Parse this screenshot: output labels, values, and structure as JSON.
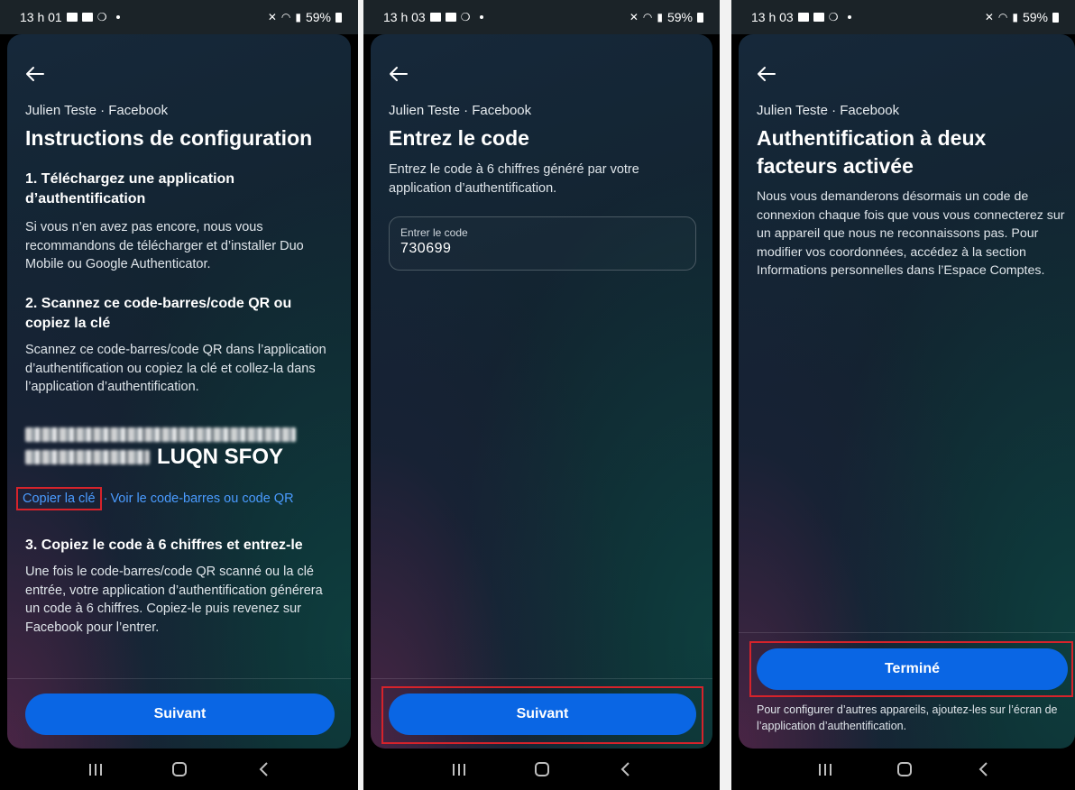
{
  "screens": [
    {
      "status": {
        "time": "13 h 01",
        "battery": "59%"
      },
      "account": "Julien Teste · Facebook",
      "title": "Instructions de configuration",
      "step1": {
        "heading": "1. Téléchargez une application d’authentification",
        "text": "Si vous n’en avez pas encore, nous vous recommandons de télécharger et d’installer Duo Mobile ou Google Authenticator."
      },
      "step2": {
        "heading": "2. Scannez ce code-barres/code QR ou copiez la clé",
        "text": "Scannez ce code-barres/code QR dans l’application d’authentification ou copiez la clé et collez-la dans l’application d’authentification.",
        "key_visible": "LUQN SFOY",
        "copy_key_label": "Copier la clé",
        "view_qr_label": "Voir le code-barres ou code QR"
      },
      "step3": {
        "heading": "3. Copiez le code à 6 chiffres et entrez-le",
        "text": "Une fois le code-barres/code QR scanné ou la clé entrée, votre application d’authentification générera un code à 6 chiffres. Copiez-le puis revenez sur Facebook pour l’entrer."
      },
      "button": "Suivant"
    },
    {
      "status": {
        "time": "13 h 03",
        "battery": "59%"
      },
      "account": "Julien Teste · Facebook",
      "title": "Entrez le code",
      "description": "Entrez le code à 6 chiffres généré par votre application d’authentification.",
      "field": {
        "label": "Entrer le code",
        "value": "730699"
      },
      "button": "Suivant"
    },
    {
      "status": {
        "time": "13 h 03",
        "battery": "59%"
      },
      "account": "Julien Teste · Facebook",
      "title": "Authentification à deux facteurs activée",
      "description": "Nous vous demanderons désormais un code de connexion chaque fois que vous vous connecterez sur un appareil que nous ne reconnaissons pas. Pour modifier vos coordonnées, accédez à la section Informations personnelles dans l’Espace Comptes.",
      "button": "Terminé",
      "footnote": "Pour configurer d’autres appareils, ajoutez-les sur l’écran de l’application d’authentification."
    }
  ],
  "colors": {
    "primary_button": "#0a66e4",
    "link": "#4a9bff",
    "highlight": "#d6232b",
    "sheet_bg": "#12232f"
  },
  "icons": [
    "back-arrow-icon",
    "recent-apps-icon",
    "home-icon",
    "back-nav-icon",
    "wifi-icon",
    "signal-icon",
    "battery-icon",
    "mute-icon"
  ]
}
